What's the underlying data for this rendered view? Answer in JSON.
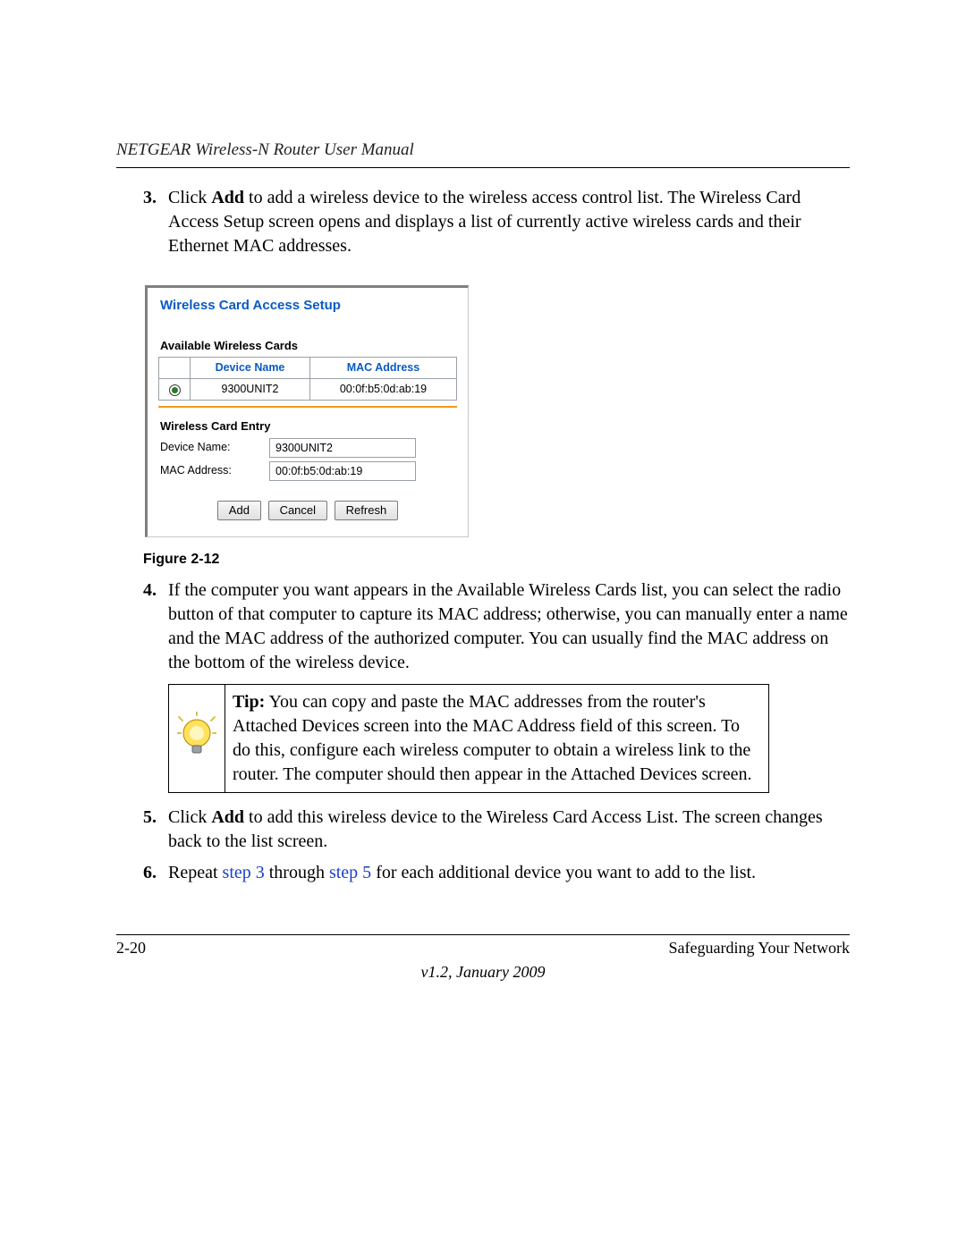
{
  "header": {
    "running_title": "NETGEAR Wireless-N Router User Manual"
  },
  "steps": {
    "s3": {
      "num": "3.",
      "prefix": "Click ",
      "bold": "Add",
      "rest": " to add a wireless device to the wireless access control list. The Wireless Card Access Setup screen opens and displays a list of currently active wireless cards and their Ethernet MAC addresses."
    },
    "s4": {
      "num": "4.",
      "text": "If the computer you want appears in the Available Wireless Cards list, you can select the radio button of that computer to capture its MAC address; otherwise, you can manually enter a name and the MAC address of the authorized computer. You can usually find the MAC address on the bottom of the wireless device."
    },
    "s5": {
      "num": "5.",
      "prefix": "Click ",
      "bold": "Add",
      "rest": " to add this wireless device to the Wireless Card Access List. The screen changes back to the list screen."
    },
    "s6": {
      "num": "6.",
      "t1": "Repeat ",
      "link1": "step 3",
      "t2": " through ",
      "link2": "step 5",
      "t3": " for each additional device you want to add to the list."
    }
  },
  "figure": {
    "caption": "Figure 2-12",
    "title": "Wireless Card Access Setup",
    "available_section": "Available Wireless Cards",
    "table": {
      "headers": {
        "device": "Device Name",
        "mac": "MAC Address"
      },
      "row": {
        "device": "9300UNIT2",
        "mac": "00:0f:b5:0d:ab:19"
      }
    },
    "entry_section": "Wireless Card Entry",
    "fields": {
      "device_label": "Device Name:",
      "device_value": "9300UNIT2",
      "mac_label": "MAC Address:",
      "mac_value": "00:0f:b5:0d:ab:19"
    },
    "buttons": {
      "add": "Add",
      "cancel": "Cancel",
      "refresh": "Refresh"
    }
  },
  "tip": {
    "label": "Tip:",
    "text": " You can copy and paste the MAC addresses from the router's Attached Devices screen into the MAC Address field of this screen. To do this, configure each wireless computer to obtain a wireless link to the router. The computer should then appear in the Attached Devices screen."
  },
  "footer": {
    "page": "2-20",
    "section": "Safeguarding Your Network",
    "version": "v1.2, January 2009"
  }
}
